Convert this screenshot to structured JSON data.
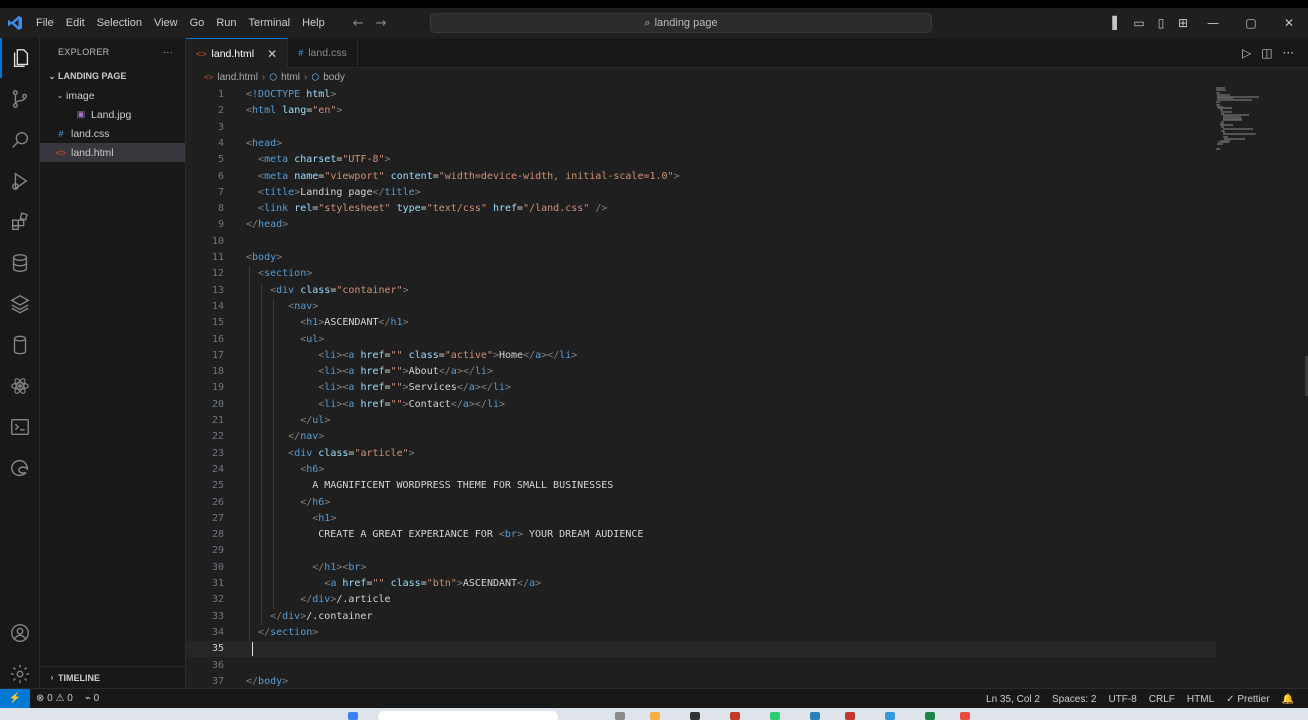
{
  "menu": [
    "File",
    "Edit",
    "Selection",
    "View",
    "Go",
    "Run",
    "Terminal",
    "Help"
  ],
  "command_center": "landing page",
  "explorer": {
    "title": "EXPLORER",
    "more": "···",
    "folder": "LANDING PAGE",
    "items": [
      {
        "label": "image",
        "kind": "folder"
      },
      {
        "label": "Land.jpg",
        "kind": "image"
      },
      {
        "label": "land.css",
        "kind": "css"
      },
      {
        "label": "land.html",
        "kind": "html"
      }
    ],
    "timeline": "TIMELINE"
  },
  "tabs": [
    {
      "label": "land.html",
      "active": true
    },
    {
      "label": "land.css",
      "active": false
    }
  ],
  "breadcrumb": [
    "land.html",
    "html",
    "body"
  ],
  "code_lines": [
    [
      {
        "c": "b",
        "t": "<"
      },
      {
        "c": "tag",
        "t": "!DOCTYPE"
      },
      {
        "c": "p",
        "t": " "
      },
      {
        "c": "attr",
        "t": "html"
      },
      {
        "c": "b",
        "t": ">"
      }
    ],
    [
      {
        "c": "b",
        "t": "<"
      },
      {
        "c": "tag",
        "t": "html"
      },
      {
        "c": "p",
        "t": " "
      },
      {
        "c": "attr",
        "t": "lang"
      },
      {
        "c": "p",
        "t": "="
      },
      {
        "c": "val",
        "t": "\"en\""
      },
      {
        "c": "b",
        "t": ">"
      }
    ],
    [],
    [
      {
        "c": "b",
        "t": "<"
      },
      {
        "c": "tag",
        "t": "head"
      },
      {
        "c": "b",
        "t": ">"
      }
    ],
    [
      {
        "c": "p",
        "t": "  "
      },
      {
        "c": "b",
        "t": "<"
      },
      {
        "c": "tag",
        "t": "meta"
      },
      {
        "c": "p",
        "t": " "
      },
      {
        "c": "attr",
        "t": "charset"
      },
      {
        "c": "p",
        "t": "="
      },
      {
        "c": "val",
        "t": "\"UTF-8\""
      },
      {
        "c": "b",
        "t": ">"
      }
    ],
    [
      {
        "c": "p",
        "t": "  "
      },
      {
        "c": "b",
        "t": "<"
      },
      {
        "c": "tag",
        "t": "meta"
      },
      {
        "c": "p",
        "t": " "
      },
      {
        "c": "attr",
        "t": "name"
      },
      {
        "c": "p",
        "t": "="
      },
      {
        "c": "val",
        "t": "\"viewport\""
      },
      {
        "c": "p",
        "t": " "
      },
      {
        "c": "attr",
        "t": "content"
      },
      {
        "c": "p",
        "t": "="
      },
      {
        "c": "val",
        "t": "\"width=device-width, initial-scale=1.0\""
      },
      {
        "c": "b",
        "t": ">"
      }
    ],
    [
      {
        "c": "p",
        "t": "  "
      },
      {
        "c": "b",
        "t": "<"
      },
      {
        "c": "tag",
        "t": "title"
      },
      {
        "c": "b",
        "t": ">"
      },
      {
        "c": "p",
        "t": "Landing page"
      },
      {
        "c": "b",
        "t": "</"
      },
      {
        "c": "tag",
        "t": "title"
      },
      {
        "c": "b",
        "t": ">"
      }
    ],
    [
      {
        "c": "p",
        "t": "  "
      },
      {
        "c": "b",
        "t": "<"
      },
      {
        "c": "tag",
        "t": "link"
      },
      {
        "c": "p",
        "t": " "
      },
      {
        "c": "attr",
        "t": "rel"
      },
      {
        "c": "p",
        "t": "="
      },
      {
        "c": "val",
        "t": "\"stylesheet\""
      },
      {
        "c": "p",
        "t": " "
      },
      {
        "c": "attr",
        "t": "type"
      },
      {
        "c": "p",
        "t": "="
      },
      {
        "c": "val",
        "t": "\"text/css\""
      },
      {
        "c": "p",
        "t": " "
      },
      {
        "c": "attr",
        "t": "href"
      },
      {
        "c": "p",
        "t": "="
      },
      {
        "c": "val",
        "t": "\"/land.css\""
      },
      {
        "c": "p",
        "t": " "
      },
      {
        "c": "b",
        "t": "/>"
      }
    ],
    [
      {
        "c": "b",
        "t": "</"
      },
      {
        "c": "tag",
        "t": "head"
      },
      {
        "c": "b",
        "t": ">"
      }
    ],
    [],
    [
      {
        "c": "b",
        "t": "<"
      },
      {
        "c": "tag",
        "t": "body"
      },
      {
        "c": "b",
        "t": ">"
      }
    ],
    [
      {
        "c": "p",
        "t": "  "
      },
      {
        "c": "b",
        "t": "<"
      },
      {
        "c": "tag",
        "t": "section"
      },
      {
        "c": "b",
        "t": ">"
      }
    ],
    [
      {
        "c": "p",
        "t": "    "
      },
      {
        "c": "b",
        "t": "<"
      },
      {
        "c": "tag",
        "t": "div"
      },
      {
        "c": "p",
        "t": " "
      },
      {
        "c": "attr",
        "t": "class"
      },
      {
        "c": "p",
        "t": "="
      },
      {
        "c": "val",
        "t": "\"container\""
      },
      {
        "c": "b",
        "t": ">"
      }
    ],
    [
      {
        "c": "p",
        "t": "       "
      },
      {
        "c": "b",
        "t": "<"
      },
      {
        "c": "tag",
        "t": "nav"
      },
      {
        "c": "b",
        "t": ">"
      }
    ],
    [
      {
        "c": "p",
        "t": "         "
      },
      {
        "c": "b",
        "t": "<"
      },
      {
        "c": "tag",
        "t": "h1"
      },
      {
        "c": "b",
        "t": ">"
      },
      {
        "c": "p",
        "t": "ASCENDANT"
      },
      {
        "c": "b",
        "t": "</"
      },
      {
        "c": "tag",
        "t": "h1"
      },
      {
        "c": "b",
        "t": ">"
      }
    ],
    [
      {
        "c": "p",
        "t": "         "
      },
      {
        "c": "b",
        "t": "<"
      },
      {
        "c": "tag",
        "t": "ul"
      },
      {
        "c": "b",
        "t": ">"
      }
    ],
    [
      {
        "c": "p",
        "t": "            "
      },
      {
        "c": "b",
        "t": "<"
      },
      {
        "c": "tag",
        "t": "li"
      },
      {
        "c": "b",
        "t": "><"
      },
      {
        "c": "tag",
        "t": "a"
      },
      {
        "c": "p",
        "t": " "
      },
      {
        "c": "attr",
        "t": "href"
      },
      {
        "c": "p",
        "t": "="
      },
      {
        "c": "val",
        "t": "\"\""
      },
      {
        "c": "p",
        "t": " "
      },
      {
        "c": "attr",
        "t": "class"
      },
      {
        "c": "p",
        "t": "="
      },
      {
        "c": "val",
        "t": "\"active\""
      },
      {
        "c": "b",
        "t": ">"
      },
      {
        "c": "p",
        "t": "Home"
      },
      {
        "c": "b",
        "t": "</"
      },
      {
        "c": "tag",
        "t": "a"
      },
      {
        "c": "b",
        "t": "></"
      },
      {
        "c": "tag",
        "t": "li"
      },
      {
        "c": "b",
        "t": ">"
      }
    ],
    [
      {
        "c": "p",
        "t": "            "
      },
      {
        "c": "b",
        "t": "<"
      },
      {
        "c": "tag",
        "t": "li"
      },
      {
        "c": "b",
        "t": "><"
      },
      {
        "c": "tag",
        "t": "a"
      },
      {
        "c": "p",
        "t": " "
      },
      {
        "c": "attr",
        "t": "href"
      },
      {
        "c": "p",
        "t": "="
      },
      {
        "c": "val",
        "t": "\"\""
      },
      {
        "c": "b",
        "t": ">"
      },
      {
        "c": "p",
        "t": "About"
      },
      {
        "c": "b",
        "t": "</"
      },
      {
        "c": "tag",
        "t": "a"
      },
      {
        "c": "b",
        "t": "></"
      },
      {
        "c": "tag",
        "t": "li"
      },
      {
        "c": "b",
        "t": ">"
      }
    ],
    [
      {
        "c": "p",
        "t": "            "
      },
      {
        "c": "b",
        "t": "<"
      },
      {
        "c": "tag",
        "t": "li"
      },
      {
        "c": "b",
        "t": "><"
      },
      {
        "c": "tag",
        "t": "a"
      },
      {
        "c": "p",
        "t": " "
      },
      {
        "c": "attr",
        "t": "href"
      },
      {
        "c": "p",
        "t": "="
      },
      {
        "c": "val",
        "t": "\"\""
      },
      {
        "c": "b",
        "t": ">"
      },
      {
        "c": "p",
        "t": "Services"
      },
      {
        "c": "b",
        "t": "</"
      },
      {
        "c": "tag",
        "t": "a"
      },
      {
        "c": "b",
        "t": "></"
      },
      {
        "c": "tag",
        "t": "li"
      },
      {
        "c": "b",
        "t": ">"
      }
    ],
    [
      {
        "c": "p",
        "t": "            "
      },
      {
        "c": "b",
        "t": "<"
      },
      {
        "c": "tag",
        "t": "li"
      },
      {
        "c": "b",
        "t": "><"
      },
      {
        "c": "tag",
        "t": "a"
      },
      {
        "c": "p",
        "t": " "
      },
      {
        "c": "attr",
        "t": "href"
      },
      {
        "c": "p",
        "t": "="
      },
      {
        "c": "val",
        "t": "\"\""
      },
      {
        "c": "b",
        "t": ">"
      },
      {
        "c": "p",
        "t": "Contact"
      },
      {
        "c": "b",
        "t": "</"
      },
      {
        "c": "tag",
        "t": "a"
      },
      {
        "c": "b",
        "t": "></"
      },
      {
        "c": "tag",
        "t": "li"
      },
      {
        "c": "b",
        "t": ">"
      }
    ],
    [
      {
        "c": "p",
        "t": "         "
      },
      {
        "c": "b",
        "t": "</"
      },
      {
        "c": "tag",
        "t": "ul"
      },
      {
        "c": "b",
        "t": ">"
      }
    ],
    [
      {
        "c": "p",
        "t": "       "
      },
      {
        "c": "b",
        "t": "</"
      },
      {
        "c": "tag",
        "t": "nav"
      },
      {
        "c": "b",
        "t": ">"
      }
    ],
    [
      {
        "c": "p",
        "t": "       "
      },
      {
        "c": "b",
        "t": "<"
      },
      {
        "c": "tag",
        "t": "div"
      },
      {
        "c": "p",
        "t": " "
      },
      {
        "c": "attr",
        "t": "class"
      },
      {
        "c": "p",
        "t": "="
      },
      {
        "c": "val",
        "t": "\"article\""
      },
      {
        "c": "b",
        "t": ">"
      }
    ],
    [
      {
        "c": "p",
        "t": "         "
      },
      {
        "c": "b",
        "t": "<"
      },
      {
        "c": "tag",
        "t": "h6"
      },
      {
        "c": "b",
        "t": ">"
      }
    ],
    [
      {
        "c": "p",
        "t": "           A MAGNIFICENT WORDPRESS THEME FOR SMALL BUSINESSES"
      }
    ],
    [
      {
        "c": "p",
        "t": "         "
      },
      {
        "c": "b",
        "t": "</"
      },
      {
        "c": "tag",
        "t": "h6"
      },
      {
        "c": "b",
        "t": ">"
      }
    ],
    [
      {
        "c": "p",
        "t": "           "
      },
      {
        "c": "b",
        "t": "<"
      },
      {
        "c": "tag",
        "t": "h1"
      },
      {
        "c": "b",
        "t": ">"
      }
    ],
    [
      {
        "c": "p",
        "t": "            CREATE A GREAT EXPERIANCE FOR "
      },
      {
        "c": "b",
        "t": "<"
      },
      {
        "c": "tag",
        "t": "br"
      },
      {
        "c": "b",
        "t": ">"
      },
      {
        "c": "p",
        "t": " YOUR DREAM AUDIENCE"
      }
    ],
    [],
    [
      {
        "c": "p",
        "t": "           "
      },
      {
        "c": "b",
        "t": "</"
      },
      {
        "c": "tag",
        "t": "h1"
      },
      {
        "c": "b",
        "t": "><"
      },
      {
        "c": "tag",
        "t": "br"
      },
      {
        "c": "b",
        "t": ">"
      }
    ],
    [
      {
        "c": "p",
        "t": "             "
      },
      {
        "c": "b",
        "t": "<"
      },
      {
        "c": "tag",
        "t": "a"
      },
      {
        "c": "p",
        "t": " "
      },
      {
        "c": "attr",
        "t": "href"
      },
      {
        "c": "p",
        "t": "="
      },
      {
        "c": "val",
        "t": "\"\""
      },
      {
        "c": "p",
        "t": " "
      },
      {
        "c": "attr",
        "t": "class"
      },
      {
        "c": "p",
        "t": "="
      },
      {
        "c": "val",
        "t": "\"btn\""
      },
      {
        "c": "b",
        "t": ">"
      },
      {
        "c": "p",
        "t": "ASCENDANT"
      },
      {
        "c": "b",
        "t": "</"
      },
      {
        "c": "tag",
        "t": "a"
      },
      {
        "c": "b",
        "t": ">"
      }
    ],
    [
      {
        "c": "p",
        "t": "         "
      },
      {
        "c": "b",
        "t": "</"
      },
      {
        "c": "tag",
        "t": "div"
      },
      {
        "c": "b",
        "t": ">"
      },
      {
        "c": "p",
        "t": "/.article"
      }
    ],
    [
      {
        "c": "p",
        "t": "    "
      },
      {
        "c": "b",
        "t": "</"
      },
      {
        "c": "tag",
        "t": "div"
      },
      {
        "c": "b",
        "t": ">"
      },
      {
        "c": "p",
        "t": "/.container"
      }
    ],
    [
      {
        "c": "p",
        "t": "  "
      },
      {
        "c": "b",
        "t": "</"
      },
      {
        "c": "tag",
        "t": "section"
      },
      {
        "c": "b",
        "t": ">"
      }
    ],
    [],
    [],
    [
      {
        "c": "b",
        "t": "</"
      },
      {
        "c": "tag",
        "t": "body"
      },
      {
        "c": "b",
        "t": ">"
      }
    ]
  ],
  "current_line": 35,
  "status": {
    "errors": "0",
    "warnings": "0",
    "ports": "0",
    "position": "Ln 35, Col 2",
    "spaces": "Spaces: 2",
    "encoding": "UTF-8",
    "eol": "CRLF",
    "language": "HTML",
    "formatter": "✓ Prettier"
  },
  "colors": {
    "accent": "#0078d4",
    "tag": "#569cd6",
    "attr": "#9cdcfe",
    "string": "#ce9178",
    "bracket": "#808080",
    "text": "#d4d4d4"
  }
}
